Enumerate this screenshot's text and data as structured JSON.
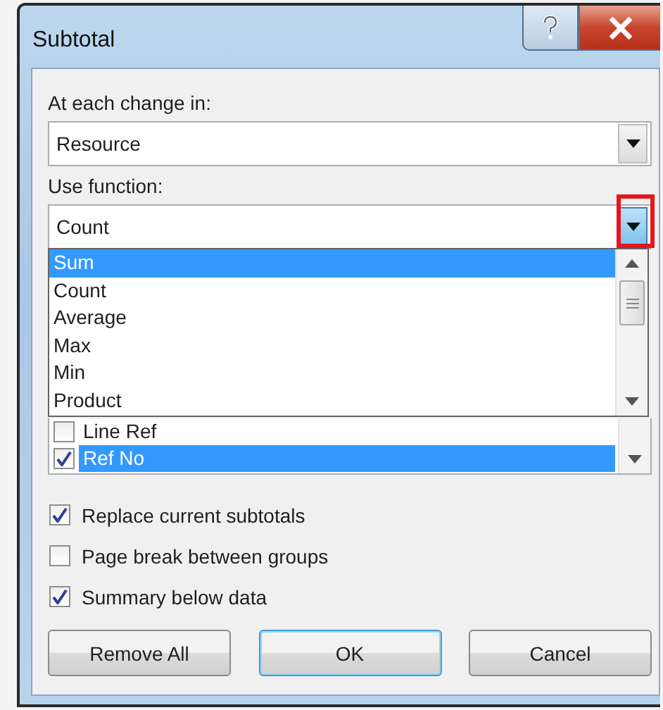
{
  "window": {
    "title": "Subtotal"
  },
  "change_field": {
    "label": "At each change in:",
    "value": "Resource"
  },
  "function_field": {
    "label": "Use function:",
    "value": "Count",
    "expanded": true,
    "highlighted": true
  },
  "function_options": [
    {
      "label": "Sum",
      "selected": true
    },
    {
      "label": "Count",
      "selected": false
    },
    {
      "label": "Average",
      "selected": false
    },
    {
      "label": "Max",
      "selected": false
    },
    {
      "label": "Min",
      "selected": false
    },
    {
      "label": "Product",
      "selected": false
    }
  ],
  "subtotal_list": [
    {
      "label": "Line Ref",
      "checked": false,
      "selected": false
    },
    {
      "label": "Ref No",
      "checked": true,
      "selected": true
    }
  ],
  "options": [
    {
      "label": "Replace current subtotals",
      "checked": true
    },
    {
      "label": "Page break between groups",
      "checked": false
    },
    {
      "label": "Summary below data",
      "checked": true
    }
  ],
  "buttons": [
    {
      "label": "Remove All",
      "default": false
    },
    {
      "label": "OK",
      "default": true
    },
    {
      "label": "Cancel",
      "default": false
    }
  ]
}
